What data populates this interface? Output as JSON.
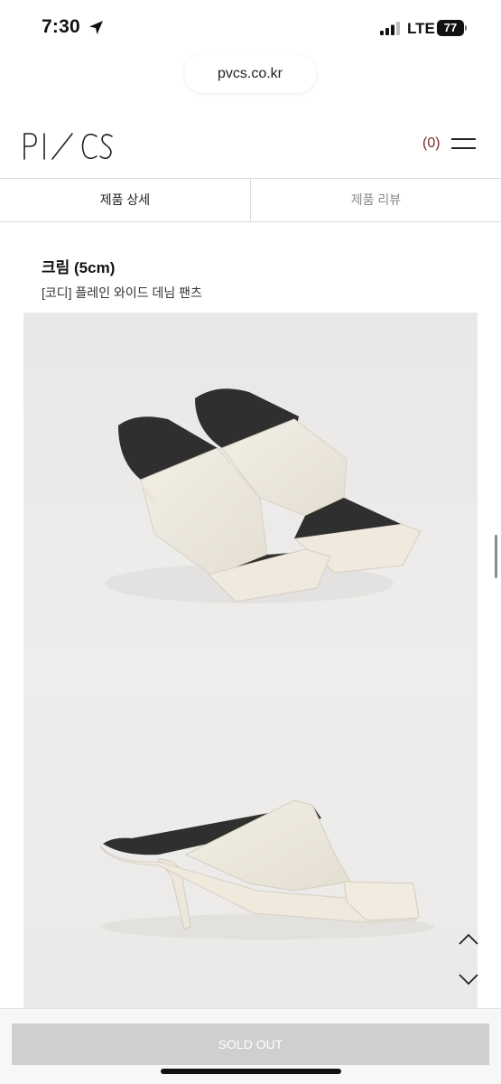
{
  "status_bar": {
    "time": "7:30",
    "network": "LTE",
    "battery": "77",
    "icons": [
      "location-arrow-icon",
      "signal-icon",
      "battery-icon"
    ]
  },
  "browser": {
    "url": "pvcs.co.kr"
  },
  "header": {
    "logo_text": "PVCS",
    "cart_count": "(0)",
    "cart_color": "#7a2a2a",
    "menu_icon": "hamburger-menu-icon"
  },
  "tabs": [
    {
      "label": "제품 상세",
      "active": true
    },
    {
      "label": "제품 리뷰",
      "active": false
    }
  ],
  "product": {
    "color_title": "크림 (5cm)",
    "coordi": "[코디] 플레인 와이드 데님 팬츠"
  },
  "scroll_buttons": {
    "up": "chevron-up-icon",
    "down": "chevron-down-icon"
  },
  "footer": {
    "soldout_label": "SOLD OUT"
  }
}
